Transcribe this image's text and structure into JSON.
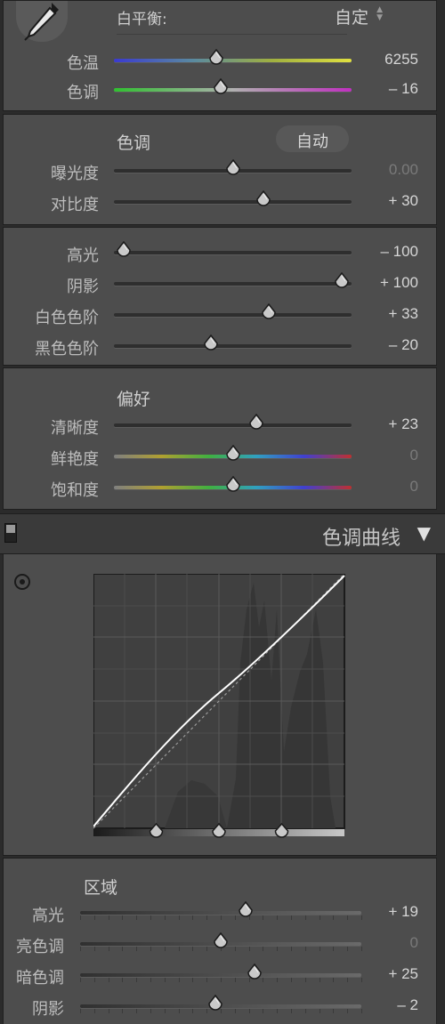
{
  "white_balance": {
    "label": "白平衡:",
    "preset": "自定",
    "sliders": [
      {
        "name": "色温",
        "value": "6255",
        "level": 0.43
      },
      {
        "name": "色调",
        "value": "– 16",
        "level": 0.45
      }
    ]
  },
  "tone": {
    "title": "色调",
    "auto_label": "自动",
    "sliders_a": [
      {
        "name": "曝光度",
        "value": "0.00",
        "level": 0.5,
        "dim": true
      },
      {
        "name": "对比度",
        "value": "+ 30",
        "level": 0.63,
        "dim": false
      }
    ],
    "sliders_b": [
      {
        "name": "高光",
        "value": "– 100",
        "level": 0.04,
        "dim": false
      },
      {
        "name": "阴影",
        "value": "+ 100",
        "level": 0.96,
        "dim": false
      },
      {
        "name": "白色色阶",
        "value": "+ 33",
        "level": 0.65,
        "dim": false
      },
      {
        "name": "黑色色阶",
        "value": "– 20",
        "level": 0.41,
        "dim": false
      }
    ]
  },
  "presence": {
    "title": "偏好",
    "sliders": [
      {
        "name": "清晰度",
        "value": "+ 23",
        "level": 0.6,
        "dim": false
      },
      {
        "name": "鲜艳度",
        "value": "0",
        "level": 0.5,
        "dim": true
      },
      {
        "name": "饱和度",
        "value": "0",
        "level": 0.5,
        "dim": true
      }
    ]
  },
  "tone_curve": {
    "title": "色调曲线",
    "collapse_glyph": "▼",
    "target_icon": "target-adjust-icon",
    "split_points": [
      0.25,
      0.5,
      0.75
    ],
    "region_title": "区域",
    "sliders": [
      {
        "name": "高光",
        "value": "+ 19",
        "level": 0.59,
        "dim": false
      },
      {
        "name": "亮色调",
        "value": "0",
        "level": 0.5,
        "dim": true
      },
      {
        "name": "暗色调",
        "value": "+ 25",
        "level": 0.62,
        "dim": false
      },
      {
        "name": "阴影",
        "value": "– 2",
        "level": 0.48,
        "dim": false
      }
    ]
  },
  "colors": {
    "panel": "#4d4d4d",
    "header_bar": "#3a3a3a",
    "curve_bg": "#404040",
    "curve_line": "#ffffff"
  }
}
